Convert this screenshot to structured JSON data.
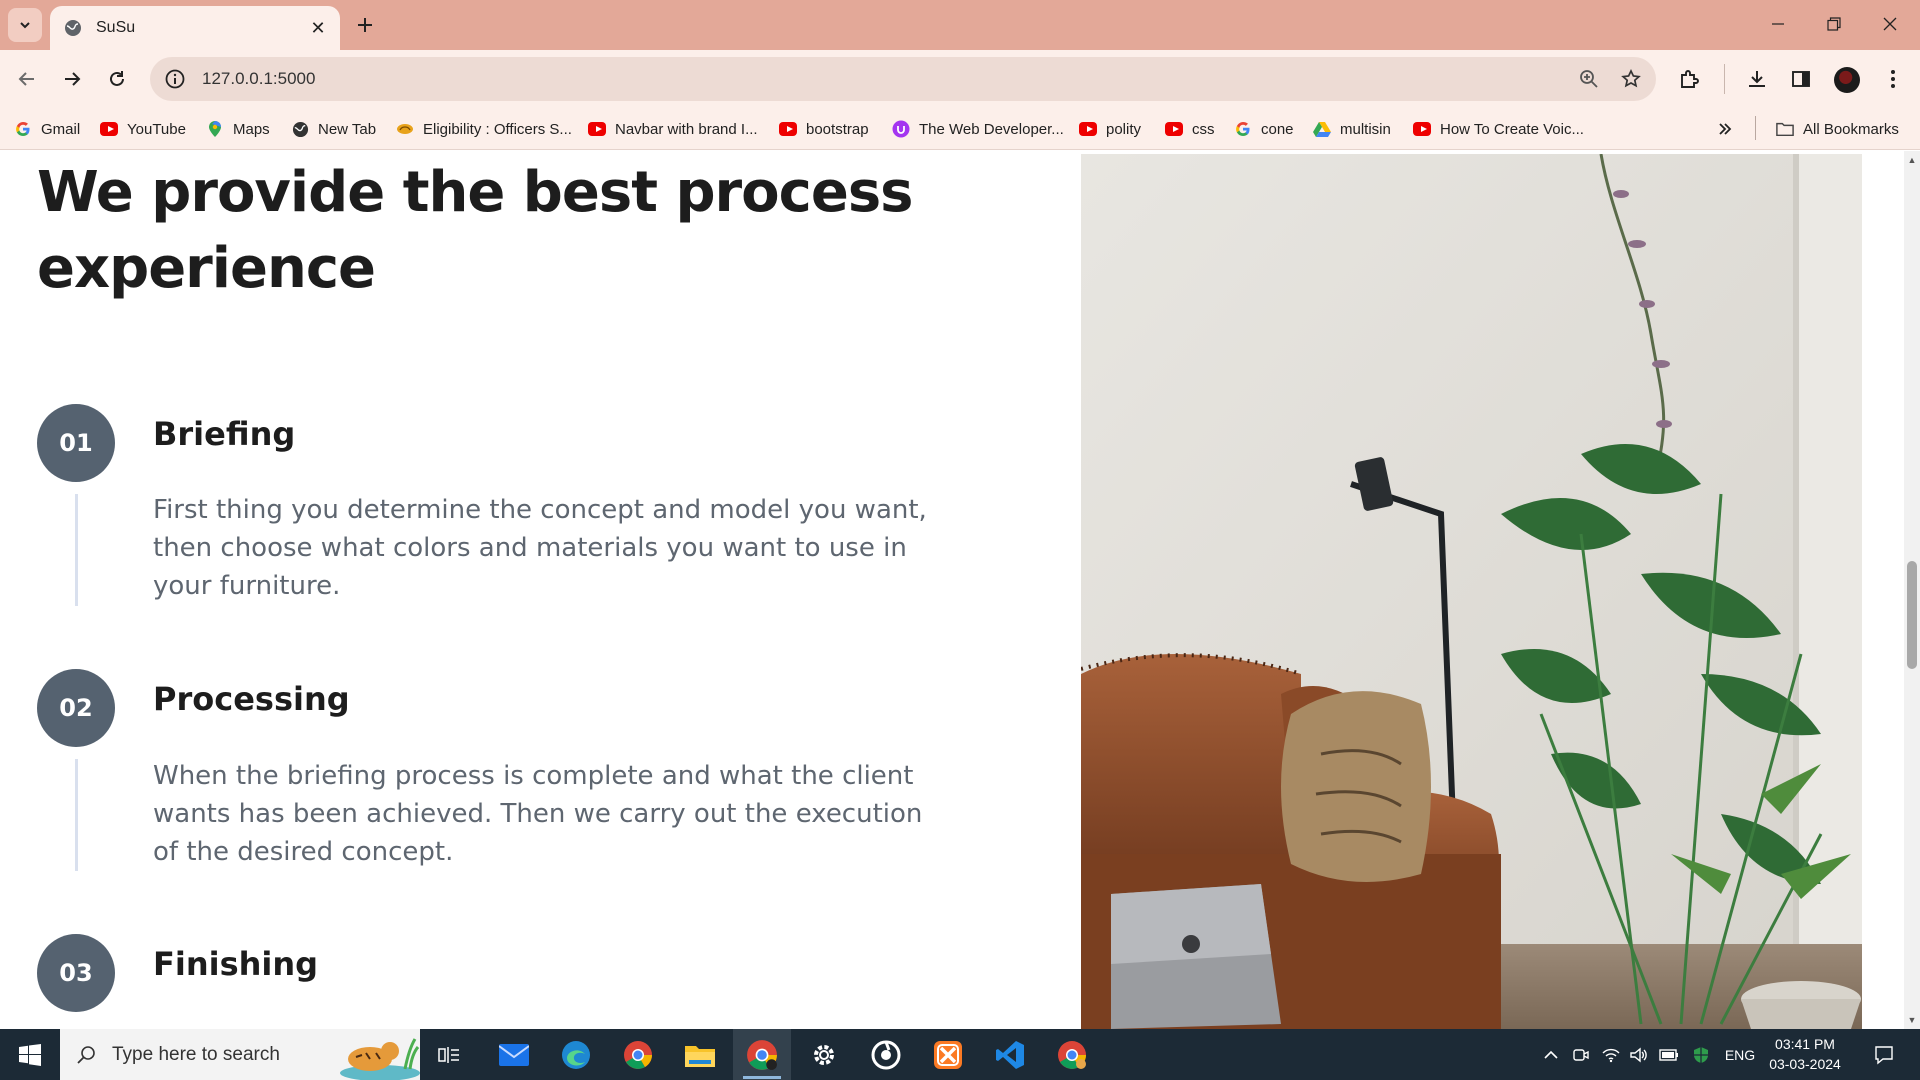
{
  "browser": {
    "tab": {
      "title": "SuSu"
    },
    "url": "127.0.0.1:5000",
    "bookmarks": [
      {
        "label": "Gmail",
        "icon": "google-icon"
      },
      {
        "label": "YouTube",
        "icon": "youtube-icon"
      },
      {
        "label": "Maps",
        "icon": "maps-icon"
      },
      {
        "label": "New Tab",
        "icon": "globe-icon"
      },
      {
        "label": "Eligibility : Officers S...",
        "icon": "emblem-icon"
      },
      {
        "label": "Navbar with brand I...",
        "icon": "youtube-icon"
      },
      {
        "label": "bootstrap",
        "icon": "youtube-icon"
      },
      {
        "label": "The Web Developer...",
        "icon": "udemy-icon"
      },
      {
        "label": "polity",
        "icon": "youtube-icon"
      },
      {
        "label": "css",
        "icon": "youtube-icon"
      },
      {
        "label": "cone",
        "icon": "google-icon"
      },
      {
        "label": "multisin",
        "icon": "drive-icon"
      },
      {
        "label": "How To Create Voic...",
        "icon": "youtube-icon"
      }
    ],
    "all_bookmarks_label": "All Bookmarks"
  },
  "page": {
    "title": "We provide the best process experience",
    "steps": [
      {
        "number": "01",
        "title": "Briefing",
        "body": "First thing you determine the concept and model you want, then choose what colors and materials you want to use in your furniture."
      },
      {
        "number": "02",
        "title": "Processing",
        "body": "When the briefing process is complete and what the client wants has been achieved. Then we carry out the execution of the desired concept."
      },
      {
        "number": "03",
        "title": "Finishing",
        "body": ""
      }
    ]
  },
  "taskbar": {
    "search_placeholder": "Type here to search",
    "language": "ENG",
    "time": "03:41 PM",
    "date": "03-03-2024"
  },
  "colors": {
    "titlebar": "#e3a898",
    "toolbar": "#fcefea",
    "step_circle": "#556270",
    "heading": "#1d1d1d",
    "body_text": "#5e6670",
    "taskbar": "#1c2a36"
  }
}
